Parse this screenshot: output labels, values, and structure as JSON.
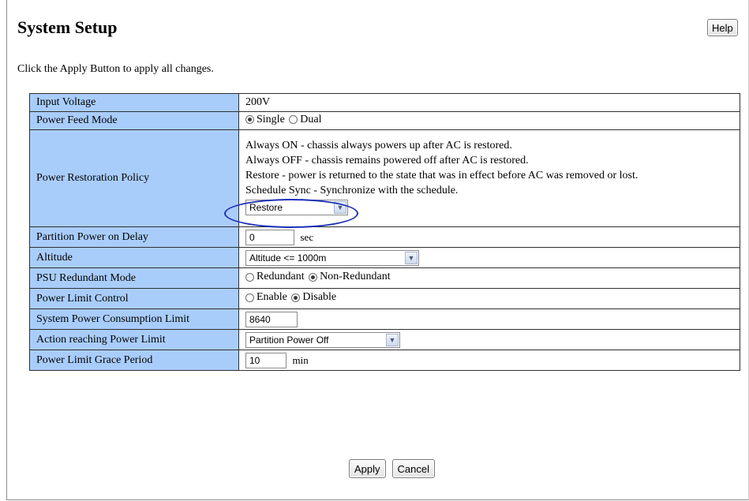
{
  "page": {
    "title": "System Setup",
    "help_label": "Help",
    "instructions": "Click the Apply Button to apply all changes."
  },
  "rows": {
    "input_voltage": {
      "label": "Input Voltage",
      "value": "200V"
    },
    "power_feed_mode": {
      "label": "Power Feed Mode",
      "options": [
        "Single",
        "Dual"
      ],
      "selected": "Single"
    },
    "power_restoration_policy": {
      "label": "Power Restoration Policy",
      "descriptions": [
        "Always ON - chassis always powers up after AC is restored.",
        "Always OFF - chassis remains powered off after AC is restored.",
        "Restore - power is returned to the state that was in effect before AC was removed or lost.",
        "Schedule Sync - Synchronize with the schedule."
      ],
      "selected": "Restore"
    },
    "partition_power_on_delay": {
      "label": "Partition Power on Delay",
      "value": "0",
      "unit": "sec"
    },
    "altitude": {
      "label": "Altitude",
      "selected": "Altitude <= 1000m"
    },
    "psu_redundant_mode": {
      "label": "PSU Redundant Mode",
      "options": [
        "Redundant",
        "Non-Redundant"
      ],
      "selected": "Non-Redundant"
    },
    "power_limit_control": {
      "label": "Power Limit Control",
      "options": [
        "Enable",
        "Disable"
      ],
      "selected": "Disable"
    },
    "system_power_consumption_limit": {
      "label": "System Power Consumption Limit",
      "value": "8640"
    },
    "action_reaching_power_limit": {
      "label": "Action reaching Power Limit",
      "selected": "Partition Power Off"
    },
    "power_limit_grace_period": {
      "label": "Power Limit Grace Period",
      "value": "10",
      "unit": "min"
    }
  },
  "actions": {
    "apply_label": "Apply",
    "cancel_label": "Cancel"
  },
  "colors": {
    "label_bg": "#a9cdfb",
    "annotation": "#1a2fb8"
  },
  "icons": {
    "dropdown": "chevron-down-icon",
    "radio": "radio-icon"
  }
}
